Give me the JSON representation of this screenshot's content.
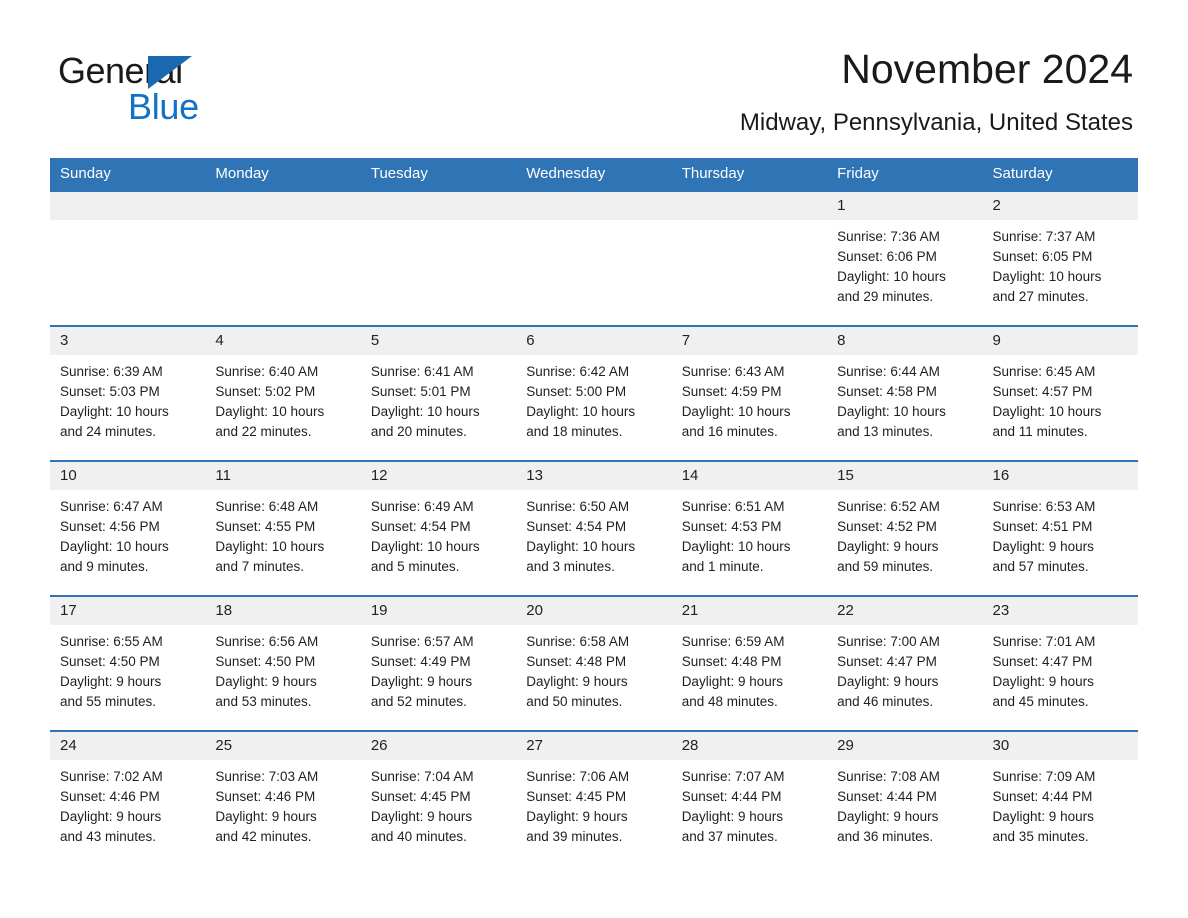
{
  "brand": {
    "name_part1": "General",
    "name_part2": "Blue"
  },
  "header": {
    "month_title": "November 2024",
    "location": "Midway, Pennsylvania, United States"
  },
  "colors": {
    "header_blue": "#2f74b5",
    "logo_blue": "#1271c4",
    "daynum_bg": "#f0f0f0"
  },
  "calendar": {
    "weekday_headers": [
      "Sunday",
      "Monday",
      "Tuesday",
      "Wednesday",
      "Thursday",
      "Friday",
      "Saturday"
    ],
    "labels": {
      "sunrise": "Sunrise:",
      "sunset": "Sunset:",
      "daylight": "Daylight:"
    },
    "weeks": [
      [
        {
          "day": "",
          "blank": true,
          "line1": "",
          "line2": "",
          "line3": "",
          "line4": ""
        },
        {
          "day": "",
          "blank": true,
          "line1": "",
          "line2": "",
          "line3": "",
          "line4": ""
        },
        {
          "day": "",
          "blank": true,
          "line1": "",
          "line2": "",
          "line3": "",
          "line4": ""
        },
        {
          "day": "",
          "blank": true,
          "line1": "",
          "line2": "",
          "line3": "",
          "line4": ""
        },
        {
          "day": "",
          "blank": true,
          "line1": "",
          "line2": "",
          "line3": "",
          "line4": ""
        },
        {
          "day": "1",
          "blank": false,
          "line1": "Sunrise: 7:36 AM",
          "line2": "Sunset: 6:06 PM",
          "line3": "Daylight: 10 hours",
          "line4": "and 29 minutes."
        },
        {
          "day": "2",
          "blank": false,
          "line1": "Sunrise: 7:37 AM",
          "line2": "Sunset: 6:05 PM",
          "line3": "Daylight: 10 hours",
          "line4": "and 27 minutes."
        }
      ],
      [
        {
          "day": "3",
          "blank": false,
          "line1": "Sunrise: 6:39 AM",
          "line2": "Sunset: 5:03 PM",
          "line3": "Daylight: 10 hours",
          "line4": "and 24 minutes."
        },
        {
          "day": "4",
          "blank": false,
          "line1": "Sunrise: 6:40 AM",
          "line2": "Sunset: 5:02 PM",
          "line3": "Daylight: 10 hours",
          "line4": "and 22 minutes."
        },
        {
          "day": "5",
          "blank": false,
          "line1": "Sunrise: 6:41 AM",
          "line2": "Sunset: 5:01 PM",
          "line3": "Daylight: 10 hours",
          "line4": "and 20 minutes."
        },
        {
          "day": "6",
          "blank": false,
          "line1": "Sunrise: 6:42 AM",
          "line2": "Sunset: 5:00 PM",
          "line3": "Daylight: 10 hours",
          "line4": "and 18 minutes."
        },
        {
          "day": "7",
          "blank": false,
          "line1": "Sunrise: 6:43 AM",
          "line2": "Sunset: 4:59 PM",
          "line3": "Daylight: 10 hours",
          "line4": "and 16 minutes."
        },
        {
          "day": "8",
          "blank": false,
          "line1": "Sunrise: 6:44 AM",
          "line2": "Sunset: 4:58 PM",
          "line3": "Daylight: 10 hours",
          "line4": "and 13 minutes."
        },
        {
          "day": "9",
          "blank": false,
          "line1": "Sunrise: 6:45 AM",
          "line2": "Sunset: 4:57 PM",
          "line3": "Daylight: 10 hours",
          "line4": "and 11 minutes."
        }
      ],
      [
        {
          "day": "10",
          "blank": false,
          "line1": "Sunrise: 6:47 AM",
          "line2": "Sunset: 4:56 PM",
          "line3": "Daylight: 10 hours",
          "line4": "and 9 minutes."
        },
        {
          "day": "11",
          "blank": false,
          "line1": "Sunrise: 6:48 AM",
          "line2": "Sunset: 4:55 PM",
          "line3": "Daylight: 10 hours",
          "line4": "and 7 minutes."
        },
        {
          "day": "12",
          "blank": false,
          "line1": "Sunrise: 6:49 AM",
          "line2": "Sunset: 4:54 PM",
          "line3": "Daylight: 10 hours",
          "line4": "and 5 minutes."
        },
        {
          "day": "13",
          "blank": false,
          "line1": "Sunrise: 6:50 AM",
          "line2": "Sunset: 4:54 PM",
          "line3": "Daylight: 10 hours",
          "line4": "and 3 minutes."
        },
        {
          "day": "14",
          "blank": false,
          "line1": "Sunrise: 6:51 AM",
          "line2": "Sunset: 4:53 PM",
          "line3": "Daylight: 10 hours",
          "line4": "and 1 minute."
        },
        {
          "day": "15",
          "blank": false,
          "line1": "Sunrise: 6:52 AM",
          "line2": "Sunset: 4:52 PM",
          "line3": "Daylight: 9 hours",
          "line4": "and 59 minutes."
        },
        {
          "day": "16",
          "blank": false,
          "line1": "Sunrise: 6:53 AM",
          "line2": "Sunset: 4:51 PM",
          "line3": "Daylight: 9 hours",
          "line4": "and 57 minutes."
        }
      ],
      [
        {
          "day": "17",
          "blank": false,
          "line1": "Sunrise: 6:55 AM",
          "line2": "Sunset: 4:50 PM",
          "line3": "Daylight: 9 hours",
          "line4": "and 55 minutes."
        },
        {
          "day": "18",
          "blank": false,
          "line1": "Sunrise: 6:56 AM",
          "line2": "Sunset: 4:50 PM",
          "line3": "Daylight: 9 hours",
          "line4": "and 53 minutes."
        },
        {
          "day": "19",
          "blank": false,
          "line1": "Sunrise: 6:57 AM",
          "line2": "Sunset: 4:49 PM",
          "line3": "Daylight: 9 hours",
          "line4": "and 52 minutes."
        },
        {
          "day": "20",
          "blank": false,
          "line1": "Sunrise: 6:58 AM",
          "line2": "Sunset: 4:48 PM",
          "line3": "Daylight: 9 hours",
          "line4": "and 50 minutes."
        },
        {
          "day": "21",
          "blank": false,
          "line1": "Sunrise: 6:59 AM",
          "line2": "Sunset: 4:48 PM",
          "line3": "Daylight: 9 hours",
          "line4": "and 48 minutes."
        },
        {
          "day": "22",
          "blank": false,
          "line1": "Sunrise: 7:00 AM",
          "line2": "Sunset: 4:47 PM",
          "line3": "Daylight: 9 hours",
          "line4": "and 46 minutes."
        },
        {
          "day": "23",
          "blank": false,
          "line1": "Sunrise: 7:01 AM",
          "line2": "Sunset: 4:47 PM",
          "line3": "Daylight: 9 hours",
          "line4": "and 45 minutes."
        }
      ],
      [
        {
          "day": "24",
          "blank": false,
          "line1": "Sunrise: 7:02 AM",
          "line2": "Sunset: 4:46 PM",
          "line3": "Daylight: 9 hours",
          "line4": "and 43 minutes."
        },
        {
          "day": "25",
          "blank": false,
          "line1": "Sunrise: 7:03 AM",
          "line2": "Sunset: 4:46 PM",
          "line3": "Daylight: 9 hours",
          "line4": "and 42 minutes."
        },
        {
          "day": "26",
          "blank": false,
          "line1": "Sunrise: 7:04 AM",
          "line2": "Sunset: 4:45 PM",
          "line3": "Daylight: 9 hours",
          "line4": "and 40 minutes."
        },
        {
          "day": "27",
          "blank": false,
          "line1": "Sunrise: 7:06 AM",
          "line2": "Sunset: 4:45 PM",
          "line3": "Daylight: 9 hours",
          "line4": "and 39 minutes."
        },
        {
          "day": "28",
          "blank": false,
          "line1": "Sunrise: 7:07 AM",
          "line2": "Sunset: 4:44 PM",
          "line3": "Daylight: 9 hours",
          "line4": "and 37 minutes."
        },
        {
          "day": "29",
          "blank": false,
          "line1": "Sunrise: 7:08 AM",
          "line2": "Sunset: 4:44 PM",
          "line3": "Daylight: 9 hours",
          "line4": "and 36 minutes."
        },
        {
          "day": "30",
          "blank": false,
          "line1": "Sunrise: 7:09 AM",
          "line2": "Sunset: 4:44 PM",
          "line3": "Daylight: 9 hours",
          "line4": "and 35 minutes."
        }
      ]
    ]
  }
}
